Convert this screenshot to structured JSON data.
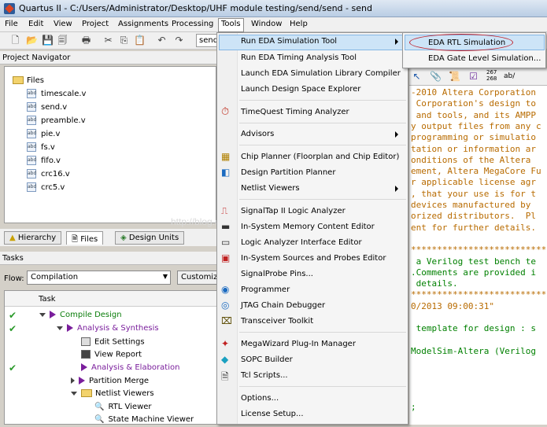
{
  "window": {
    "title": "Quartus II - C:/Users/Administrator/Desktop/UHF module testing/send/send - send"
  },
  "menubar": {
    "items": [
      "File",
      "Edit",
      "View",
      "Project",
      "Assignments",
      "Processing",
      "Tools",
      "Window",
      "Help"
    ]
  },
  "toolbar": {
    "entity_value": "send"
  },
  "project_navigator": {
    "title": "Project Navigator",
    "root": "Files",
    "files": [
      "timescale.v",
      "send.v",
      "preamble.v",
      "pie.v",
      "fs.v",
      "fifo.v",
      "crc16.v",
      "crc5.v"
    ],
    "tabs": [
      "Hierarchy",
      "Files",
      "Design Units"
    ]
  },
  "tasks": {
    "title": "Tasks",
    "flow_label": "Flow:",
    "flow_value": "Compilation",
    "customize_label": "Customize",
    "column": "Task",
    "rows": [
      {
        "label": "Compile Design",
        "done": true
      },
      {
        "label": "Analysis & Synthesis",
        "done": true
      },
      {
        "label": "Edit Settings",
        "done": false
      },
      {
        "label": "View Report",
        "done": false
      },
      {
        "label": "Analysis & Elaboration",
        "done": true
      },
      {
        "label": "Partition Merge",
        "done": false
      },
      {
        "label": "Netlist Viewers",
        "done": false
      },
      {
        "label": "RTL Viewer",
        "done": false
      },
      {
        "label": "State Machine Viewer",
        "done": false
      }
    ]
  },
  "tools_menu": {
    "items": [
      "Run EDA Simulation Tool",
      "Run EDA Timing Analysis Tool",
      "Launch EDA Simulation Library Compiler",
      "Launch Design Space Explorer",
      "TimeQuest Timing Analyzer",
      "Advisors",
      "Chip Planner (Floorplan and Chip Editor)",
      "Design Partition Planner",
      "Netlist Viewers",
      "SignalTap II Logic Analyzer",
      "In-System Memory Content Editor",
      "Logic Analyzer Interface Editor",
      "In-System Sources and Probes Editor",
      "SignalProbe Pins...",
      "Programmer",
      "JTAG Chain Debugger",
      "Transceiver Toolkit",
      "MegaWizard Plug-In Manager",
      "SOPC Builder",
      "Tcl Scripts...",
      "Options...",
      "License Setup..."
    ]
  },
  "sub_menu": {
    "items": [
      "EDA RTL Simulation",
      "EDA Gate Level Simulation..."
    ]
  },
  "editor": {
    "toolbar_text": "267 268",
    "toolbar_ab": "ab/",
    "lines": [
      "-2010 Altera Corporation",
      " Corporation's design to",
      " and tools, and its AMPP",
      "y output files from any c",
      "programming or simulatio",
      "tation or information ar",
      "onditions of the Altera ",
      "ement, Altera MegaCore Fu",
      "r applicable license agr",
      ", that your use is for t",
      "devices manufactured by ",
      "orized distributors.  Pl",
      "ent for further details.",
      "",
      "**************************",
      " a Verilog test bench te",
      ".Comments are provided i",
      " details.",
      "**************************",
      "0/2013 09:00:31\"",
      "",
      " template for design : s",
      "",
      "ModelSim-Altera (Verilog",
      "",
      "",
      "",
      "",
      ";"
    ]
  },
  "watermark": "http://blog.csdn.net/wyrmcul"
}
